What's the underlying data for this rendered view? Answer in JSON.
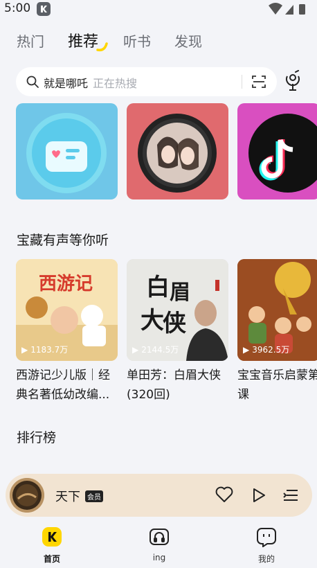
{
  "status_bar": {
    "time": "5:00"
  },
  "tabs": [
    {
      "label": "热门"
    },
    {
      "label": "推荐"
    },
    {
      "label": "听书"
    },
    {
      "label": "发现"
    }
  ],
  "search": {
    "text": "就是哪吒",
    "hint": "正在热搜"
  },
  "section_treasure": {
    "title": "宝藏有声等你听"
  },
  "albums": [
    {
      "play_count": "1183.7万",
      "title_line1": "西游记少儿版｜经",
      "title_line2": "典名著低幼改编..."
    },
    {
      "play_count": "2144.5万",
      "title_line1": "单田芳：白眉大侠",
      "title_line2": "(320回)"
    },
    {
      "play_count": "3962.5万",
      "title_line1": "宝宝音乐启蒙第",
      "title_line2": "课"
    }
  ],
  "section_rank": {
    "title": "排行榜"
  },
  "player": {
    "song": "天下",
    "badge": "会员"
  },
  "nav": [
    {
      "label": "首页"
    },
    {
      "label": "ing"
    },
    {
      "label": "我的"
    }
  ],
  "colors": {
    "accent": "#ffd600",
    "player_bg": "#f2e4d2",
    "background": "#f3f4f8"
  }
}
